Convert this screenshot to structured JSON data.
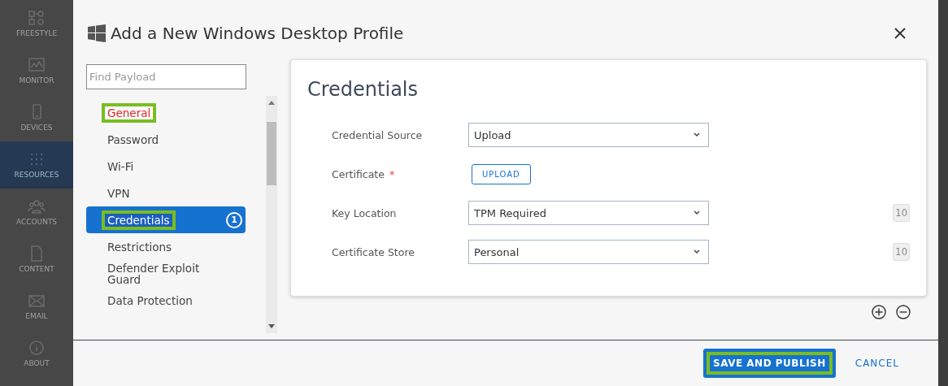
{
  "nav": [
    {
      "label": "FREESTYLE",
      "selected": false
    },
    {
      "label": "MONITOR",
      "selected": false
    },
    {
      "label": "DEVICES",
      "selected": false
    },
    {
      "label": "RESOURCES",
      "selected": true
    },
    {
      "label": "ACCOUNTS",
      "selected": false
    },
    {
      "label": "CONTENT",
      "selected": false
    },
    {
      "label": "EMAIL",
      "selected": false
    },
    {
      "label": "ABOUT",
      "selected": false
    }
  ],
  "dialog": {
    "title": "Add a New Windows Desktop Profile",
    "search": {
      "placeholder": "Find Payload"
    },
    "payloads": [
      {
        "label": "General",
        "selected": false,
        "error": true,
        "highlighted": true
      },
      {
        "label": "Password",
        "selected": false,
        "error": false,
        "highlighted": false
      },
      {
        "label": "Wi-Fi",
        "selected": false,
        "error": false,
        "highlighted": false
      },
      {
        "label": "VPN",
        "selected": false,
        "error": false,
        "highlighted": false
      },
      {
        "label": "Credentials",
        "selected": true,
        "error": false,
        "highlighted": true,
        "count": "1"
      },
      {
        "label": "Restrictions",
        "selected": false,
        "error": false,
        "highlighted": false
      },
      {
        "label": "Defender Exploit Guard",
        "selected": false,
        "error": false,
        "highlighted": false
      },
      {
        "label": "Data Protection",
        "selected": false,
        "error": false,
        "highlighted": false
      }
    ],
    "panel": {
      "title": "Credentials",
      "fields": [
        {
          "kind": "select",
          "label": "Credential Source",
          "value": "Upload"
        },
        {
          "kind": "upload",
          "label": "Certificate",
          "required_mark": "*",
          "button": "UPLOAD"
        },
        {
          "kind": "select",
          "label": "Key Location",
          "value": "TPM Required",
          "badge": "10"
        },
        {
          "kind": "select",
          "label": "Certificate Store",
          "value": "Personal",
          "badge": "10"
        }
      ]
    },
    "footer": {
      "primary": {
        "label": "SAVE AND PUBLISH",
        "highlighted": true
      },
      "secondary": {
        "label": "CANCEL"
      }
    }
  }
}
